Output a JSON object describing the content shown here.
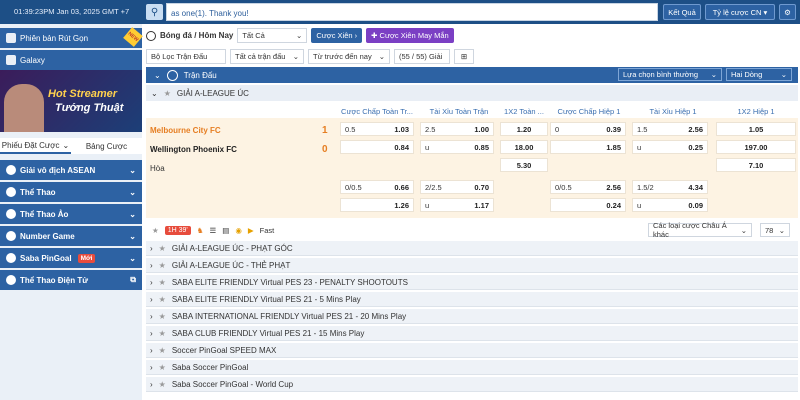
{
  "topbar": {
    "time": "01:39:23PM Jan 03, 2025 GMT +7",
    "message": "as one(1). Thank you!",
    "result_btn": "Kết Quả",
    "odds_btn": "Tỷ lệ cược CN"
  },
  "sidebar": {
    "promo1": "Phiên bản Rút Gọn",
    "promo2": "Galaxy",
    "banner_line1": "Hot Streamer",
    "banner_line2": "Tướng Thuật",
    "tab1": "Phiếu Đặt Cược",
    "tab2": "Bảng Cược",
    "items": [
      {
        "label": "Giải vô địch ASEAN"
      },
      {
        "label": "Thể Thao"
      },
      {
        "label": "Thể Thao Ảo"
      },
      {
        "label": "Number Game"
      },
      {
        "label": "Saba PinGoal",
        "badge": "Mới"
      },
      {
        "label": "Thể Thao Điện Tử"
      }
    ]
  },
  "filters": {
    "sport": "Bóng đá / Hôm Nay",
    "all": "Tất Cả",
    "parlay": "Cược Xiên",
    "lucky_parlay": "Cược Xiên May Mắn",
    "league_filter": "Bộ Lọc Trận Đấu",
    "all_matches": "Tất cả trận đấu",
    "sort": "Từ trước đến nay",
    "count": "(55 / 55) Giải"
  },
  "header": {
    "title": "Trận Đấu",
    "pref": "Lựa chọn bình thường",
    "lines": "Hai Dòng"
  },
  "league": "GIẢI A-LEAGUE ÚC",
  "columns": [
    "Cược Chấp Toàn Tr...",
    "Tài Xỉu Toàn Trận",
    "1X2 Toàn ...",
    "Cược Chấp Hiệp 1",
    "Tài Xỉu Hiệp 1",
    "1X2 Hiệp 1"
  ],
  "match": {
    "home": "Melbourne City FC",
    "away": "Wellington Phoenix FC",
    "draw": "Hòa",
    "home_score": "1",
    "away_score": "0",
    "r1": {
      "hcap_h": "0.5",
      "hcap_o": "1.03",
      "ou_h": "2.5",
      "ou_o": "1.00",
      "x12": "1.20",
      "h1_h": "0",
      "h1_o": "0.39",
      "h1ou_h": "1.5",
      "h1ou_o": "2.56",
      "h1x": "1.05"
    },
    "r2": {
      "hcap_o": "0.84",
      "ou_h": "u",
      "ou_o": "0.85",
      "x12": "18.00",
      "h1_o": "1.85",
      "h1ou_h": "u",
      "h1ou_o": "0.25",
      "h1x": "197.00"
    },
    "r3": {
      "x12": "5.30",
      "h1x": "7.10"
    },
    "r4": {
      "hcap_h": "0/0.5",
      "hcap_o": "0.66",
      "ou_h": "2/2.5",
      "ou_o": "0.70",
      "h1_h": "0/0.5",
      "h1_o": "2.56",
      "h1ou_h": "1.5/2",
      "h1ou_o": "4.34"
    },
    "r5": {
      "hcap_o": "1.26",
      "ou_h": "u",
      "ou_o": "1.17",
      "h1_o": "0.24",
      "h1ou_h": "u",
      "h1ou_o": "0.09"
    }
  },
  "controls": {
    "live": "1H 39'",
    "fast": "Fast",
    "odds_type": "Các loại cược Châu Á khác",
    "num": "78"
  },
  "leagues": [
    "GIẢI A-LEAGUE ÚC - PHẠT GÓC",
    "GIẢI A-LEAGUE ÚC - THẺ PHẠT",
    "SABA ELITE FRIENDLY Virtual PES 23 - PENALTY SHOOTOUTS",
    "SABA ELITE FRIENDLY Virtual PES 21 - 5 Mins Play",
    "SABA INTERNATIONAL FRIENDLY Virtual PES 21 - 20 Mins Play",
    "SABA CLUB FRIENDLY Virtual PES 21 - 15 Mins Play",
    "Soccer PinGoal SPEED MAX",
    "Saba Soccer PinGoal",
    "Saba Soccer PinGoal - World Cup"
  ]
}
